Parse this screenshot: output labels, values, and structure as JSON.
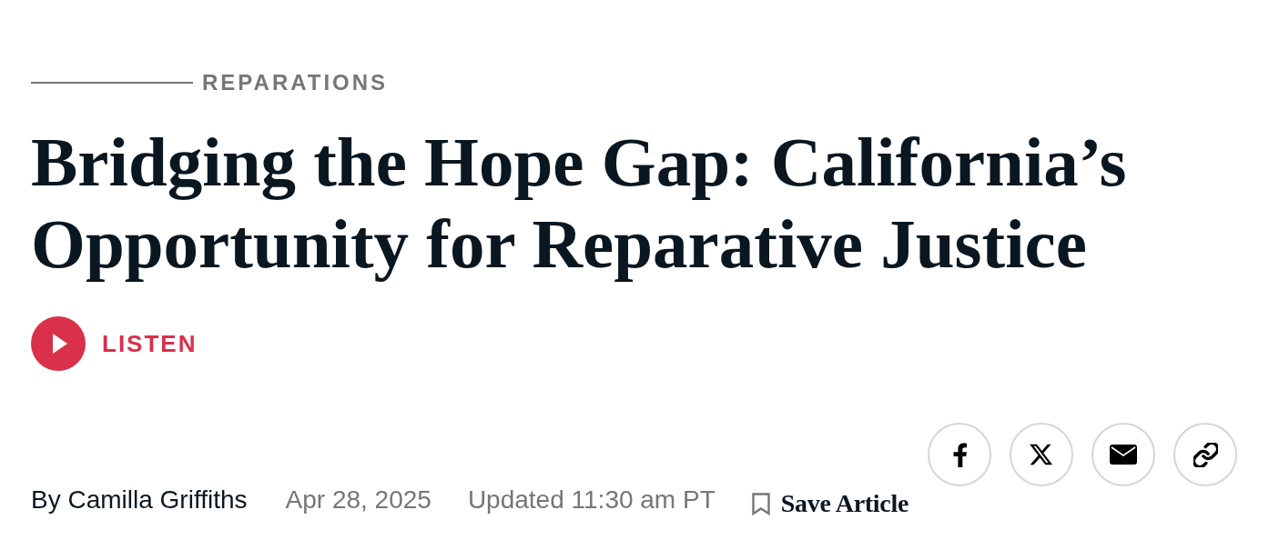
{
  "section": {
    "label": "REPARATIONS"
  },
  "headline": "Bridging the Hope Gap: California’s Opportunity for Reparative Justice",
  "audio": {
    "label": "LISTEN"
  },
  "byline": {
    "author": "By Camilla Griffiths",
    "date": "Apr 28, 2025",
    "updated": "Updated 11:30 am PT",
    "save": {
      "label": "Save Article",
      "saved": false
    }
  },
  "share": [
    {
      "kind": "facebook"
    },
    {
      "kind": "x"
    },
    {
      "kind": "email"
    },
    {
      "kind": "link"
    }
  ]
}
